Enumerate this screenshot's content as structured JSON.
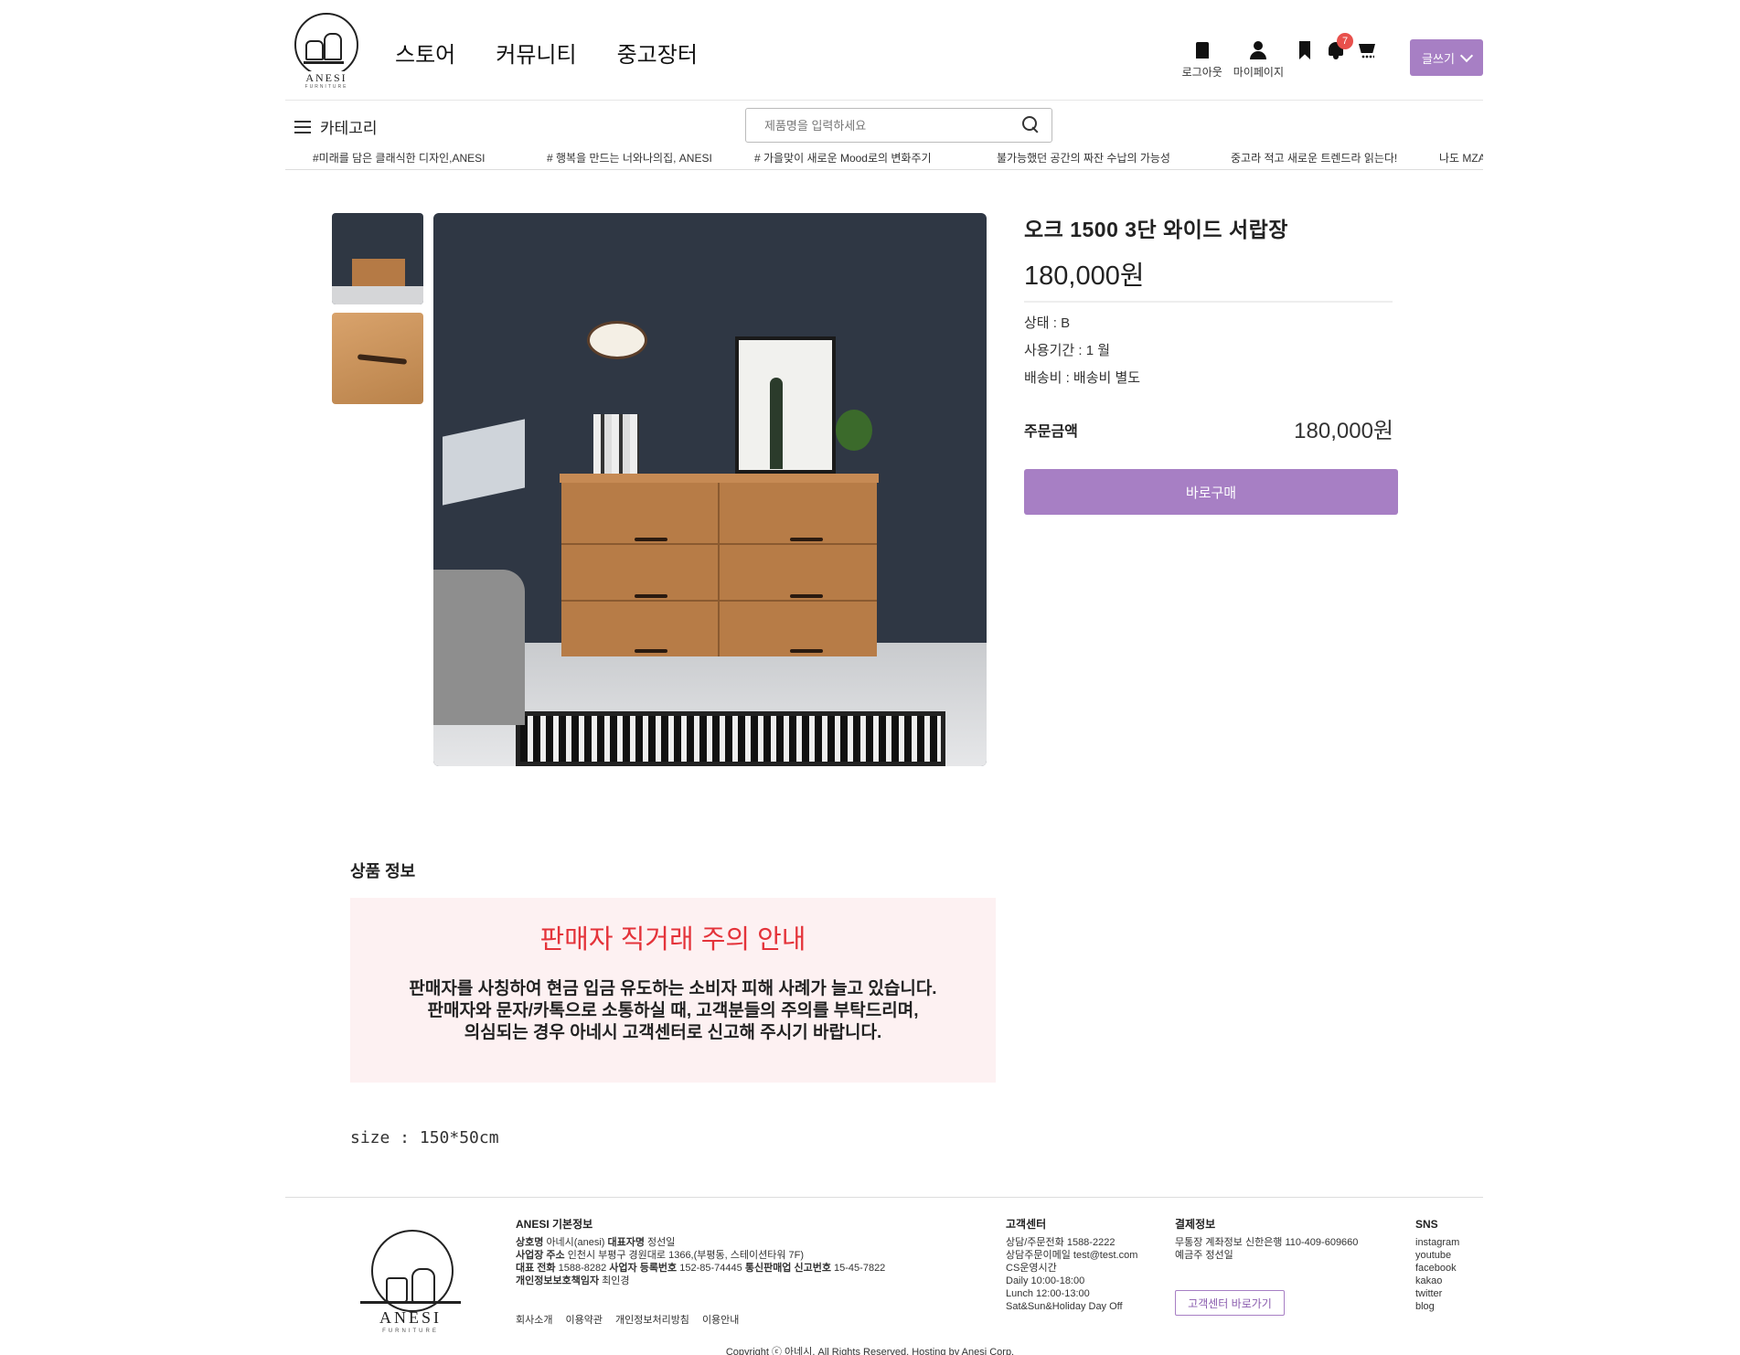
{
  "header": {
    "brand": "ANESI",
    "brand_sub": "FURNITURE",
    "nav": [
      "스토어",
      "커뮤니티",
      "중고장터"
    ],
    "user_actions": [
      {
        "label": "로그아웃",
        "icon": "logout-icon"
      },
      {
        "label": "마이페이지",
        "icon": "user-icon"
      },
      {
        "label": "",
        "icon": "bookmark-icon"
      },
      {
        "label": "",
        "icon": "bell-icon",
        "badge": "7"
      },
      {
        "label": "",
        "icon": "cart-icon"
      }
    ],
    "notification_count": "7",
    "write_button": "글쓰기"
  },
  "subbar": {
    "category_label": "카테고리",
    "search_placeholder": "제품명을 입력하세요",
    "ticker": [
      "#미래를 담은 클래식한 디자인,ANESI",
      "# 행복을 만드는 너와나의집, ANESI",
      "# 가을맞이 새로운 Mood로의 변화주기",
      "불가능했던 공간의 짜잔 수납의 가능성",
      "중고라 적고 새로운 트렌드라 읽는다!",
      "나도 MZA"
    ]
  },
  "product": {
    "title": "오크 1500 3단 와이드 서랍장",
    "price": "180,000원",
    "condition": "상태 : B",
    "usage_period": "사용기간 : 1 월",
    "shipping": "배송비 : 배송비 별도",
    "order_label": "주문금액",
    "order_value": "180,000원",
    "buy_button": "바로구매"
  },
  "detail": {
    "section_title": "상품 정보",
    "notice_title": "판매자 직거래 주의 안내",
    "notice_lines": [
      "판매자를 사칭하여 현금 입금 유도하는 소비자 피해 사례가 늘고 있습니다.",
      "판매자와 문자/카톡으로 소통하실 때, 고객분들의 주의를 부탁드리며,",
      "의심되는 경우 아네시 고객센터로 신고해 주시기 바랍니다."
    ],
    "size": "size : 150*50cm"
  },
  "footer": {
    "brand": "ANESI",
    "brand_sub": "FURNITURE",
    "info_title": "ANESI 기본정보",
    "info": [
      {
        "k1": "상호명",
        "v1": "아네시(anesi)",
        "k2": "대표자명",
        "v2": "정선일"
      },
      {
        "k1": "사업장 주소",
        "v1": "인천시 부평구 경원대로 1366,(부평동, 스테이션타워 7F)",
        "k2": "",
        "v2": ""
      },
      {
        "k1": "대표 전화",
        "v1": "1588-8282",
        "k2": "사업자 등록번호",
        "v2": "152-85-74445",
        "k3": "통신판매업 신고번호",
        "v3": "15-45-7822"
      },
      {
        "k1": "개인정보보호책임자",
        "v1": "최인경",
        "k2": "",
        "v2": ""
      }
    ],
    "links": [
      "회사소개",
      "이용약관",
      "개인정보처리방침",
      "이용안내"
    ],
    "cs_title": "고객센터",
    "cs": [
      "상담/주문전화 1588-2222",
      "상담주문이메일 test@test.com",
      "CS운영시간",
      "Daily 10:00-18:00",
      "Lunch 12:00-13:00",
      "Sat&Sun&Holiday Day Off"
    ],
    "pay_title": "결제정보",
    "pay": [
      "무통장 계좌정보 신한은행 110-409-609660",
      "예금주 정선일"
    ],
    "cs_button": "고객센터 바로가기",
    "sns_title": "SNS",
    "sns": [
      "instagram",
      "youtube",
      "facebook",
      "kakao",
      "twitter",
      "blog"
    ],
    "copyright": "Copyright ⓒ 아네시. All Rights Reserved. Hosting by Anesi Corp."
  },
  "colors": {
    "accent": "#a77fc4",
    "badge": "#e8504c",
    "notice_bg": "#fdf1f2",
    "notice_title": "#e4333a"
  }
}
